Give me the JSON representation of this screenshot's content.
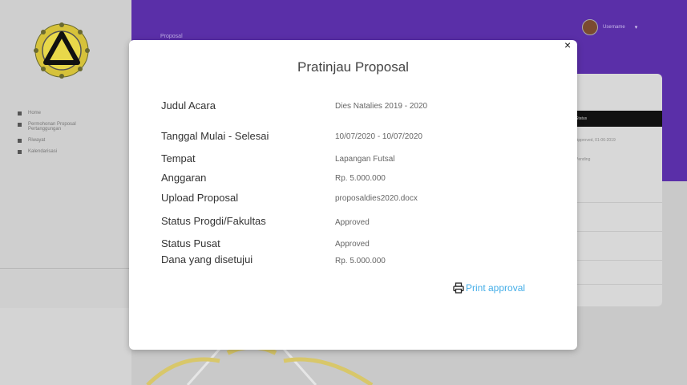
{
  "sidebar": {
    "items": [
      {
        "label": "Home"
      },
      {
        "label": "Permohonan Proposal",
        "sub": "Pertanggungan"
      },
      {
        "label": "Riwayat"
      },
      {
        "label": "Kalendarisasi"
      }
    ]
  },
  "topbar": {
    "title": "Proposal",
    "user_name": "Username"
  },
  "background_card": {
    "header": "Status",
    "row1": "Approved, 01-06-2019",
    "row2": "Pending"
  },
  "modal": {
    "title": "Pratinjau Proposal",
    "close_label": "×",
    "fields": [
      {
        "label": "Judul Acara",
        "value": "Dies Natalies 2019 - 2020"
      },
      {
        "label": "Tanggal Mulai - Selesai",
        "value": "10/07/2020 - 10/07/2020"
      },
      {
        "label": "Tempat",
        "value": "Lapangan Futsal"
      },
      {
        "label": "Anggaran",
        "value": "Rp. 5.000.000"
      },
      {
        "label": "Upload Proposal",
        "value": "proposaldies2020.docx"
      },
      {
        "label": "Status Progdi/Fakultas",
        "value": "Approved"
      },
      {
        "label": "Status Pusat",
        "value": "Approved"
      },
      {
        "label": "Dana yang disetujui",
        "value": "Rp. 5.000.000"
      }
    ],
    "print_label": "Print approval"
  },
  "icons": {
    "print": "printer-icon",
    "close": "close-icon",
    "logo": "university-logo",
    "avatar": "user-avatar"
  },
  "colors": {
    "topbar": "#5a2fa8",
    "link": "#45aee8",
    "logo_gold": "#d6c23a"
  }
}
